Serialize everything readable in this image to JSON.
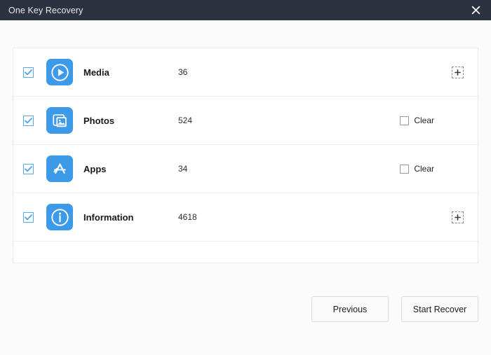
{
  "window": {
    "title": "One Key Recovery",
    "close_icon": "close-icon",
    "titlebar_color": "#2b3340"
  },
  "accent_color": "#3d9ae8",
  "list": {
    "rows": [
      {
        "checked": true,
        "icon": "media-play-icon",
        "label": "Media",
        "count": "36",
        "control": "expand",
        "expand_icon": "plus-icon"
      },
      {
        "checked": true,
        "icon": "photos-icon",
        "label": "Photos",
        "count": "524",
        "control": "clear",
        "clear_label": "Clear",
        "clear_checked": false
      },
      {
        "checked": true,
        "icon": "apps-icon",
        "label": "Apps",
        "count": "34",
        "control": "clear",
        "clear_label": "Clear",
        "clear_checked": false
      },
      {
        "checked": true,
        "icon": "information-icon",
        "label": "Information",
        "count": "4618",
        "control": "expand",
        "expand_icon": "plus-icon"
      }
    ]
  },
  "footer": {
    "previous_label": "Previous",
    "start_recover_label": "Start Recover"
  }
}
